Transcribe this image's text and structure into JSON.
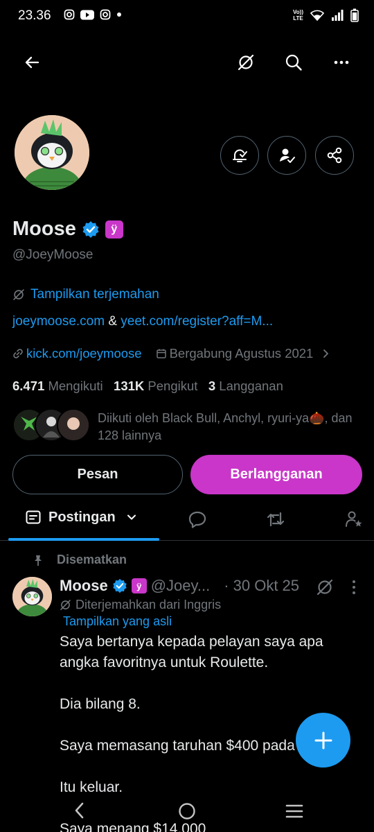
{
  "status_bar": {
    "time": "23.36",
    "network_label": "LTE"
  },
  "profile": {
    "name": "Moose",
    "handle": "@JoeyMoose",
    "translate_link": "Tampilkan terjemahan",
    "link1": "joeymoose.com",
    "link_separator": " & ",
    "link2": "yeet.com/register?aff=M...",
    "kick_link": "kick.com/joeymoose",
    "joined": "Bergabung Agustus 2021",
    "following_count": "6.471",
    "following_label": "Mengikuti",
    "followers_count": "131K",
    "followers_label": "Pengikut",
    "subscriptions_count": "3",
    "subscriptions_label": "Langganan",
    "followed_by": "Diikuti oleh Black Bull, Anchyl, ryuri-ya🌰, dan 128 lainnya",
    "message_button": "Pesan",
    "subscribe_button": "Berlangganan"
  },
  "tabs": {
    "active": "Postingan"
  },
  "post": {
    "pinned_label": "Disematkan",
    "name": "Moose",
    "handle": "@Joey...",
    "date": "· 30 Okt 25",
    "translated_from": "Diterjemahkan dari Inggris",
    "show_original": "Tampilkan yang asli",
    "paragraphs": [
      "Saya bertanya kepada pelayan saya apa angka favoritnya untuk Roulette.",
      "Dia bilang 8.",
      "Saya memasang taruhan $400 pada 8.",
      "Itu keluar.",
      "Saya menang $14.000"
    ]
  },
  "colors": {
    "accent": "#1d9bf0",
    "subscribe": "#c936c9",
    "muted": "#71767b",
    "background": "#000000"
  }
}
